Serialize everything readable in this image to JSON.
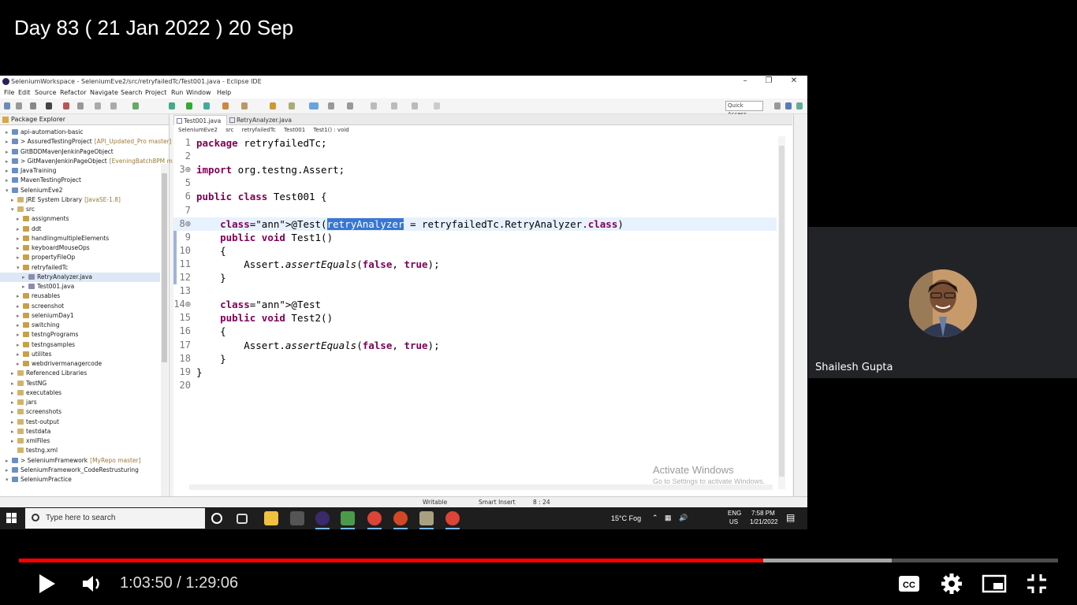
{
  "video": {
    "title": "Day 83 ( 21 Jan 2022 ) 20 Sep",
    "current_time": "1:03:50",
    "separator": " / ",
    "duration": "1:29:06",
    "progress_fraction": 0.7164,
    "buffer_fraction": 0.84
  },
  "eclipse": {
    "window_title": "SeleniumWorkspace - SeleniumEve2/src/retryfailedTc/Test001.java - Eclipse IDE",
    "menu": [
      "File",
      "Edit",
      "Source",
      "Refactor",
      "Navigate",
      "Search",
      "Project",
      "Run",
      "Window",
      "Help"
    ],
    "quick_access": "Quick Access",
    "package_explorer": {
      "title": "Package Explorer",
      "items": [
        {
          "label": "api-automation-basic",
          "decor": ""
        },
        {
          "label": "> AssuredTestingProject",
          "decor": "[API_Updated_Pro master]"
        },
        {
          "label": "GitBDDMavenJenkinPageObject",
          "decor": ""
        },
        {
          "label": "> GitMavenJenkinPageObject",
          "decor": "[EveningBatch8PM m"
        },
        {
          "label": "JavaTraining",
          "decor": ""
        },
        {
          "label": "MavenTestingProject",
          "decor": ""
        },
        {
          "label": "SeleniumEve2",
          "decor": ""
        },
        {
          "label": "JRE System Library",
          "decor": "[JavaSE-1.8]"
        },
        {
          "label": "src",
          "decor": ""
        },
        {
          "label": "assignments",
          "decor": ""
        },
        {
          "label": "ddt",
          "decor": ""
        },
        {
          "label": "handlingmultipleElements",
          "decor": ""
        },
        {
          "label": "keyboardMouseOps",
          "decor": ""
        },
        {
          "label": "propertyFileOp",
          "decor": ""
        },
        {
          "label": "retryfailedTc",
          "decor": ""
        },
        {
          "label": "RetryAnalyzer.java",
          "decor": ""
        },
        {
          "label": "Test001.java",
          "decor": ""
        },
        {
          "label": "reusables",
          "decor": ""
        },
        {
          "label": "screenshot",
          "decor": ""
        },
        {
          "label": "seleniumDay1",
          "decor": ""
        },
        {
          "label": "switching",
          "decor": ""
        },
        {
          "label": "testngPrograms",
          "decor": ""
        },
        {
          "label": "testngsamples",
          "decor": ""
        },
        {
          "label": "utilites",
          "decor": ""
        },
        {
          "label": "webdrivermanagercode",
          "decor": ""
        },
        {
          "label": "Referenced Libraries",
          "decor": ""
        },
        {
          "label": "TestNG",
          "decor": ""
        },
        {
          "label": "executables",
          "decor": ""
        },
        {
          "label": "jars",
          "decor": ""
        },
        {
          "label": "screenshots",
          "decor": ""
        },
        {
          "label": "test-output",
          "decor": ""
        },
        {
          "label": "testdata",
          "decor": ""
        },
        {
          "label": "xmlFiles",
          "decor": ""
        },
        {
          "label": "testng.xml",
          "decor": ""
        },
        {
          "label": "> SeleniumFramework",
          "decor": "[MyRepo master]"
        },
        {
          "label": "SeleniumFramework_CodeRestrusturing",
          "decor": ""
        },
        {
          "label": "SeleniumPractice",
          "decor": ""
        }
      ]
    },
    "editor": {
      "tabs": [
        "Test001.java",
        "RetryAnalyzer.java"
      ],
      "breadcrumb": [
        "SeleniumEve2",
        "src",
        "retryfailedTc",
        "Test001",
        "Test1() : void"
      ],
      "lines": [
        {
          "n": "1",
          "code": "package retryfailedTc;"
        },
        {
          "n": "2",
          "code": ""
        },
        {
          "n": "3⊕",
          "code": "import org.testng.Assert;"
        },
        {
          "n": "5",
          "code": ""
        },
        {
          "n": "6",
          "code": "public class Test001 {"
        },
        {
          "n": "7",
          "code": ""
        },
        {
          "n": "8⊕",
          "code": "    @Test(retryAnalyzer = retryfailedTc.RetryAnalyzer.class)"
        },
        {
          "n": "9",
          "code": "    public void Test1()"
        },
        {
          "n": "10",
          "code": "    {"
        },
        {
          "n": "11",
          "code": "        Assert.assertEquals(false, true);"
        },
        {
          "n": "12",
          "code": "    }"
        },
        {
          "n": "13",
          "code": ""
        },
        {
          "n": "14⊕",
          "code": "    @Test"
        },
        {
          "n": "15",
          "code": "    public void Test2()"
        },
        {
          "n": "16",
          "code": "    {"
        },
        {
          "n": "17",
          "code": "        Assert.assertEquals(false, true);"
        },
        {
          "n": "18",
          "code": "    }"
        },
        {
          "n": "19",
          "code": "}"
        },
        {
          "n": "20",
          "code": ""
        }
      ]
    },
    "status": {
      "writable": "Writable",
      "insert_mode": "Smart Insert",
      "position": "8 : 24"
    },
    "activate": {
      "title": "Activate Windows",
      "subtitle": "Go to Settings to activate Windows."
    }
  },
  "taskbar": {
    "search_placeholder": "Type here to search",
    "weather": "15°C  Fog",
    "lang_top": "ENG",
    "lang_bottom": "US",
    "clock_time": "7:58 PM",
    "clock_date": "1/21/2022"
  },
  "webcam": {
    "name": "Shailesh Gupta"
  }
}
